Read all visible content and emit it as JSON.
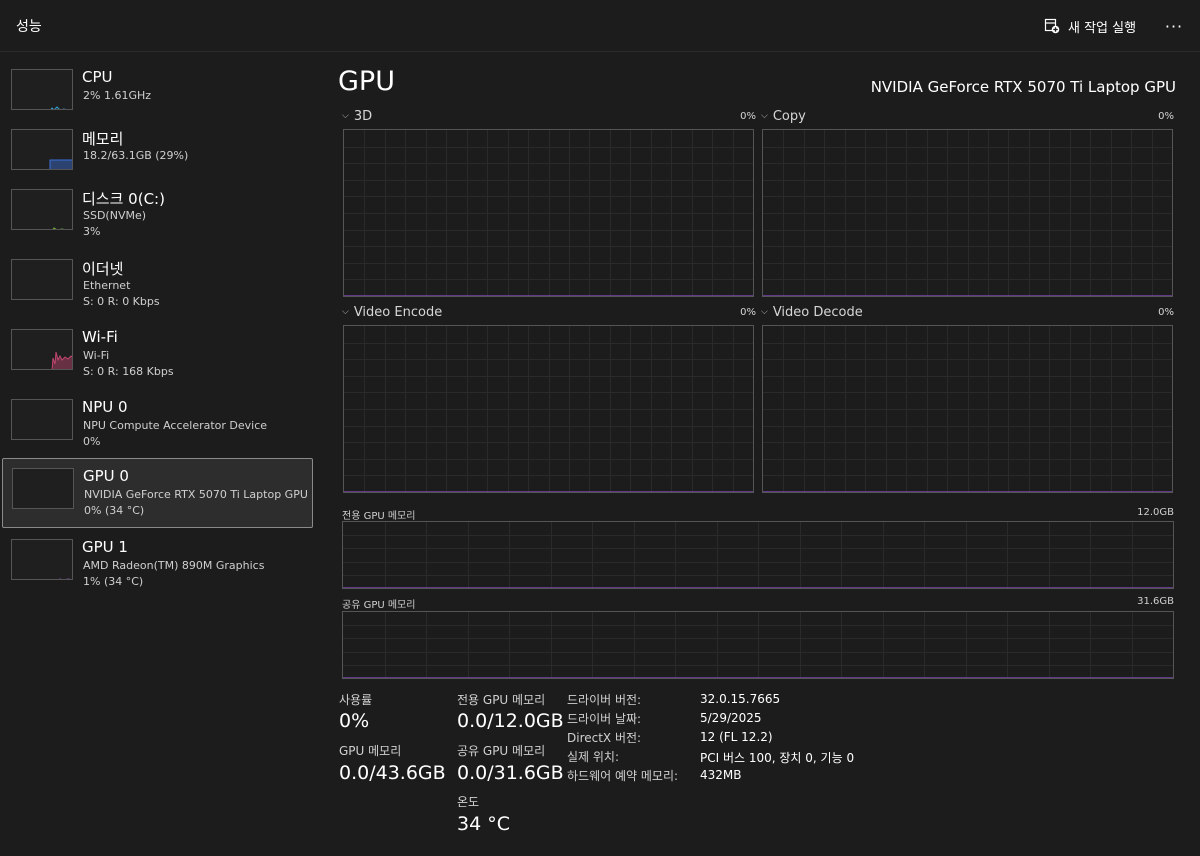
{
  "header": {
    "title": "성능",
    "new_task_label": "새 작업 실행",
    "more_label": "···"
  },
  "sidebar": {
    "items": [
      {
        "name": "CPU",
        "sub1": "2% 1.61GHz",
        "sub2": "",
        "color": "#2ea3d9"
      },
      {
        "name": "메모리",
        "sub1": "18.2/63.1GB (29%)",
        "sub2": "",
        "color": "#3b6fd8"
      },
      {
        "name": "디스크 0(C:)",
        "sub1": "SSD(NVMe)",
        "sub2": "3%",
        "color": "#6fae3a"
      },
      {
        "name": "이더넷",
        "sub1": "Ethernet",
        "sub2": "S: 0  R: 0 Kbps",
        "color": "#b3597a"
      },
      {
        "name": "Wi-Fi",
        "sub1": "Wi-Fi",
        "sub2": "S: 0  R: 168 Kbps",
        "color": "#c0456f"
      },
      {
        "name": "NPU 0",
        "sub1": "NPU Compute Accelerator Device",
        "sub2": "0%",
        "color": "#2ea3d9"
      },
      {
        "name": "GPU 0",
        "sub1": "NVIDIA GeForce RTX 5070 Ti Laptop GPU",
        "sub2": "0% (34 °C)",
        "color": "#8e4fcf"
      },
      {
        "name": "GPU 1",
        "sub1": "AMD Radeon(TM) 890M Graphics",
        "sub2": "1% (34 °C)",
        "color": "#8e4fcf"
      }
    ]
  },
  "main": {
    "title": "GPU",
    "device": "NVIDIA GeForce RTX 5070 Ti Laptop GPU",
    "engines": [
      {
        "label": "3D",
        "pct": "0%"
      },
      {
        "label": "Copy",
        "pct": "0%"
      },
      {
        "label": "Video Encode",
        "pct": "0%"
      },
      {
        "label": "Video Decode",
        "pct": "0%"
      }
    ],
    "dedicated_label": "전용 GPU 메모리",
    "dedicated_max": "12.0GB",
    "shared_label": "공유 GPU 메모리",
    "shared_max": "31.6GB",
    "graph_color": "#8e4fcf"
  },
  "stats": {
    "usage_label": "사용률",
    "usage_value": "0%",
    "gpu_mem_label": "GPU 메모리",
    "gpu_mem_value": "0.0/43.6GB",
    "dedicated_label": "전용 GPU 메모리",
    "dedicated_value": "0.0/12.0GB",
    "shared_label": "공유 GPU 메모리",
    "shared_value": "0.0/31.6GB",
    "temp_label": "온도",
    "temp_value": "34 °C"
  },
  "info": [
    {
      "key": "드라이버 버전:",
      "value": "32.0.15.7665"
    },
    {
      "key": "드라이버 날짜:",
      "value": "5/29/2025"
    },
    {
      "key": "DirectX 버전:",
      "value": "12 (FL 12.2)"
    },
    {
      "key": "실제 위치:",
      "value": "PCI 버스 100, 장치 0, 기능 0"
    },
    {
      "key": "하드웨어 예약 메모리:",
      "value": "432MB"
    }
  ]
}
